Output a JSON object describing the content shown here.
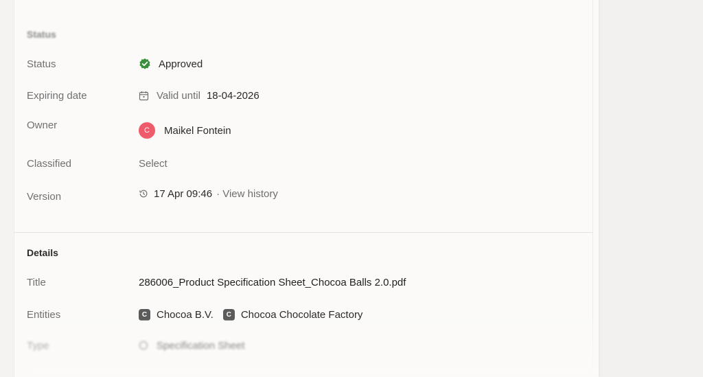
{
  "status_section": {
    "heading": "Status",
    "status_label": "Status",
    "status_value": "Approved",
    "status_color": "#3a8f3a",
    "expiring_label": "Expiring date",
    "valid_until_text": "Valid until",
    "valid_until_date": "18-04-2026",
    "owner_label": "Owner",
    "owner_initial": "C",
    "owner_name": "Maikel Fontein",
    "owner_avatar_color": "#ef5b6a",
    "classified_label": "Classified",
    "classified_value": "Select",
    "version_label": "Version",
    "version_value": "17 Apr 09:46",
    "view_history": "· View history"
  },
  "details_section": {
    "heading": "Details",
    "title_label": "Title",
    "title_value": "286006_Product Specification Sheet_Chocoa Balls 2.0.pdf",
    "entities_label": "Entities",
    "entities": [
      {
        "initial": "C",
        "name": "Chocoa B.V."
      },
      {
        "initial": "C",
        "name": "Chocoa Chocolate Factory"
      }
    ],
    "type_label": "Type",
    "type_value": "Specification Sheet"
  }
}
